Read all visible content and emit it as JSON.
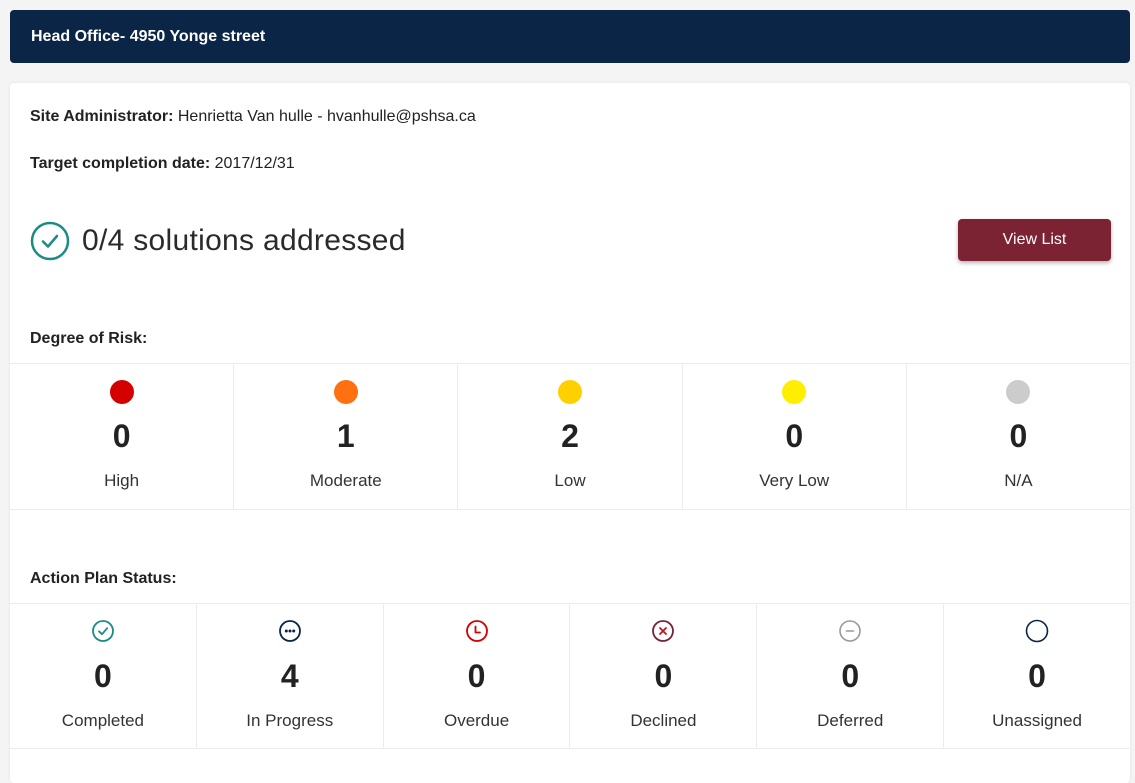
{
  "header": {
    "title": "Head Office- 4950 Yonge street"
  },
  "site_admin": {
    "label": "Site Administrator:",
    "value": "Henrietta Van hulle - hvanhulle@pshsa.ca"
  },
  "target_date": {
    "label": "Target completion date:",
    "value": "2017/12/31"
  },
  "summary": {
    "text": "0/4 solutions addressed",
    "icon": "check-circle-icon"
  },
  "view_list_button": {
    "label": "View List"
  },
  "risk": {
    "label": "Degree of Risk:",
    "items": [
      {
        "count": "0",
        "name": "High",
        "color": "#d40000"
      },
      {
        "count": "1",
        "name": "Moderate",
        "color": "#ff7010"
      },
      {
        "count": "2",
        "name": "Low",
        "color": "#ffd000"
      },
      {
        "count": "0",
        "name": "Very Low",
        "color": "#ffee00"
      },
      {
        "count": "0",
        "name": "N/A",
        "color": "#cccccc"
      }
    ]
  },
  "status": {
    "label": "Action Plan Status:",
    "items": [
      {
        "count": "0",
        "name": "Completed",
        "icon": "check-circle-icon",
        "color": "#1a8c83"
      },
      {
        "count": "4",
        "name": "In Progress",
        "icon": "ellipsis-circle-icon",
        "color": "#0b2547"
      },
      {
        "count": "0",
        "name": "Overdue",
        "icon": "clock-icon",
        "color": "#d40000"
      },
      {
        "count": "0",
        "name": "Declined",
        "icon": "x-circle-icon",
        "color": "#7b2233"
      },
      {
        "count": "0",
        "name": "Deferred",
        "icon": "minus-circle-icon",
        "color": "#999999"
      },
      {
        "count": "0",
        "name": "Unassigned",
        "icon": "empty-circle-icon",
        "color": "#0b2547"
      }
    ]
  }
}
